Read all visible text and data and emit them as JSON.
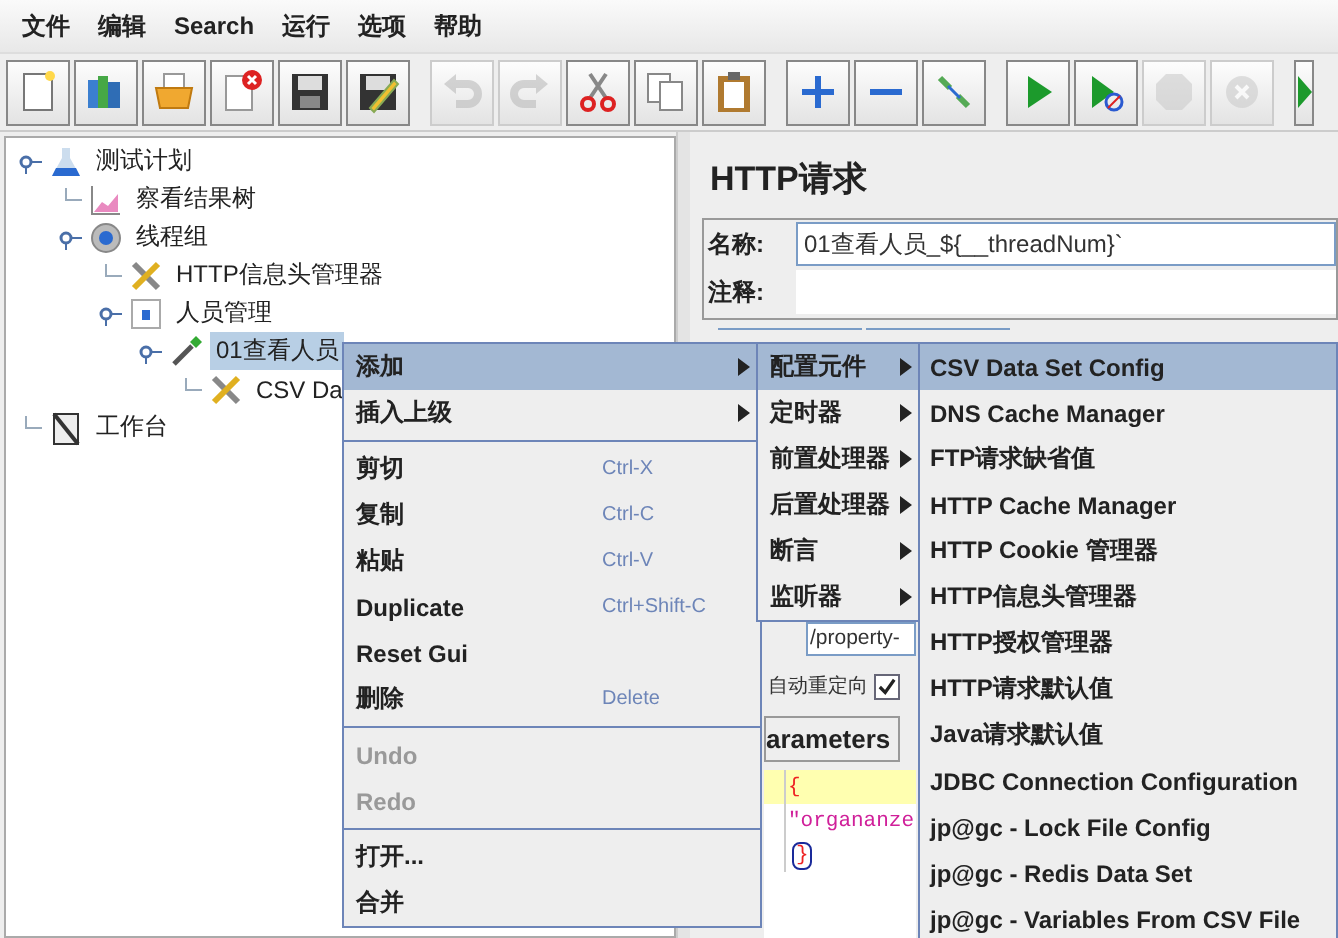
{
  "menubar": [
    "文件",
    "编辑",
    "Search",
    "运行",
    "选项",
    "帮助"
  ],
  "toolbar": [
    {
      "kind": "new",
      "disabled": false
    },
    {
      "kind": "templates",
      "disabled": false
    },
    {
      "kind": "open",
      "disabled": false
    },
    {
      "kind": "close",
      "disabled": false
    },
    {
      "kind": "save",
      "disabled": false
    },
    {
      "kind": "saveas",
      "disabled": false
    },
    {
      "kind": "sep"
    },
    {
      "kind": "undo",
      "disabled": true
    },
    {
      "kind": "redo",
      "disabled": true
    },
    {
      "kind": "cut",
      "disabled": false
    },
    {
      "kind": "copy",
      "disabled": false
    },
    {
      "kind": "paste",
      "disabled": false
    },
    {
      "kind": "sep"
    },
    {
      "kind": "expand",
      "disabled": false
    },
    {
      "kind": "collapse",
      "disabled": false
    },
    {
      "kind": "toggle",
      "disabled": false
    },
    {
      "kind": "sep"
    },
    {
      "kind": "start",
      "disabled": false
    },
    {
      "kind": "startnopause",
      "disabled": false
    },
    {
      "kind": "stop",
      "disabled": true
    },
    {
      "kind": "shutdown",
      "disabled": true
    },
    {
      "kind": "sep"
    },
    {
      "kind": "remote",
      "disabled": false
    }
  ],
  "tree": [
    {
      "label": "测试计划",
      "kind": "plan",
      "selected": false,
      "children": [
        {
          "label": "察看结果树",
          "kind": "listener",
          "selected": false
        },
        {
          "label": "线程组",
          "kind": "threadgroup",
          "selected": false,
          "children": [
            {
              "label": "HTTP信息头管理器",
              "kind": "config",
              "selected": false
            },
            {
              "label": "人员管理",
              "kind": "controller",
              "selected": false,
              "children": [
                {
                  "label": "01查看人员",
                  "kind": "sampler",
                  "selected": true,
                  "children": [
                    {
                      "label": "CSV Da",
                      "kind": "config",
                      "selected": false
                    }
                  ]
                }
              ]
            }
          ]
        }
      ]
    },
    {
      "label": "工作台",
      "kind": "workbench",
      "selected": false
    }
  ],
  "panel": {
    "title": "HTTP请求",
    "name_label": "名称:",
    "name_value": "01查看人员_${__threadNum}`",
    "comment_label": "注释:",
    "path_value": "/property-",
    "redirect_label": "自动重定向",
    "redirect_checked": true,
    "params_tab": "arameters",
    "code_lines": [
      {
        "text": "{",
        "kind": "brace"
      },
      {
        "text": "\"organanze",
        "kind": "string"
      },
      {
        "text": "}",
        "kind": "brace-match"
      }
    ]
  },
  "context_menu": [
    {
      "kind": "item",
      "label": "添加",
      "submenu": true,
      "selected": true,
      "disabled": false
    },
    {
      "kind": "item",
      "label": "插入上级",
      "submenu": true,
      "selected": false,
      "disabled": false
    },
    {
      "kind": "separator"
    },
    {
      "kind": "item",
      "label": "剪切",
      "shortcut": "Ctrl-X",
      "selected": false,
      "disabled": false
    },
    {
      "kind": "item",
      "label": "复制",
      "shortcut": "Ctrl-C",
      "selected": false,
      "disabled": false
    },
    {
      "kind": "item",
      "label": "粘贴",
      "shortcut": "Ctrl-V",
      "selected": false,
      "disabled": false
    },
    {
      "kind": "item",
      "label": "Duplicate",
      "shortcut": "Ctrl+Shift-C",
      "selected": false,
      "disabled": false
    },
    {
      "kind": "item",
      "label": "Reset Gui",
      "selected": false,
      "disabled": false
    },
    {
      "kind": "item",
      "label": "删除",
      "shortcut": "Delete",
      "selected": false,
      "disabled": false
    },
    {
      "kind": "separator"
    },
    {
      "kind": "item",
      "label": "Undo",
      "selected": false,
      "disabled": true
    },
    {
      "kind": "item",
      "label": "Redo",
      "selected": false,
      "disabled": true
    },
    {
      "kind": "separator"
    },
    {
      "kind": "item",
      "label": "打开...",
      "selected": false,
      "disabled": false
    },
    {
      "kind": "item",
      "label": "合并",
      "selected": false,
      "disabled": false
    }
  ],
  "add_menu": [
    {
      "label": "配置元件",
      "selected": true
    },
    {
      "label": "定时器",
      "selected": false
    },
    {
      "label": "前置处理器",
      "selected": false
    },
    {
      "label": "后置处理器",
      "selected": false
    },
    {
      "label": "断言",
      "selected": false
    },
    {
      "label": "监听器",
      "selected": false
    }
  ],
  "config_menu": [
    {
      "label": "CSV Data Set Config",
      "selected": true
    },
    {
      "label": "DNS Cache Manager",
      "selected": false
    },
    {
      "label": "FTP请求缺省值",
      "selected": false
    },
    {
      "label": "HTTP Cache Manager",
      "selected": false
    },
    {
      "label": "HTTP Cookie 管理器",
      "selected": false
    },
    {
      "label": "HTTP信息头管理器",
      "selected": false
    },
    {
      "label": "HTTP授权管理器",
      "selected": false
    },
    {
      "label": "HTTP请求默认值",
      "selected": false
    },
    {
      "label": "Java请求默认值",
      "selected": false
    },
    {
      "label": "JDBC Connection Configuration",
      "selected": false
    },
    {
      "label": "jp@gc - Lock File Config",
      "selected": false
    },
    {
      "label": "jp@gc - Redis Data Set",
      "selected": false
    },
    {
      "label": "jp@gc - Variables From CSV File",
      "selected": false
    }
  ]
}
